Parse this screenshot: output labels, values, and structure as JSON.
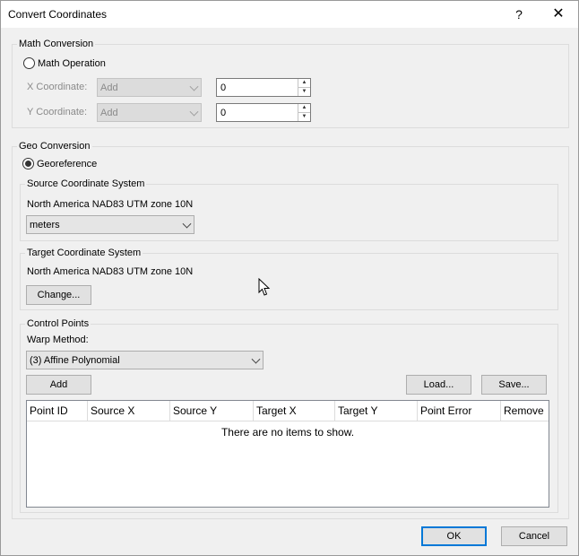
{
  "window": {
    "title": "Convert Coordinates",
    "help_glyph": "?",
    "close_glyph": "✕"
  },
  "math_conversion": {
    "group_label": "Math Conversion",
    "radio_label": "Math Operation",
    "x_label": "X Coordinate:",
    "x_operation": "Add",
    "x_value": "0",
    "y_label": "Y Coordinate:",
    "y_operation": "Add",
    "y_value": "0"
  },
  "geo_conversion": {
    "group_label": "Geo Conversion",
    "radio_label": "Georeference",
    "source": {
      "group_label": "Source Coordinate System",
      "system_name": "North America NAD83 UTM zone 10N",
      "unit": "meters"
    },
    "target": {
      "group_label": "Target Coordinate System",
      "system_name": "North America NAD83 UTM zone 10N",
      "change_button": "Change..."
    },
    "control_points": {
      "group_label": "Control Points",
      "warp_label": "Warp Method:",
      "warp_method": "(3) Affine Polynomial",
      "add_button": "Add",
      "load_button": "Load...",
      "save_button": "Save...",
      "columns": [
        "Point ID",
        "Source X",
        "Source Y",
        "Target X",
        "Target Y",
        "Point Error",
        "Remove"
      ],
      "empty_text": "There are no items to show."
    }
  },
  "footer": {
    "ok_button": "OK",
    "cancel_button": "Cancel"
  }
}
